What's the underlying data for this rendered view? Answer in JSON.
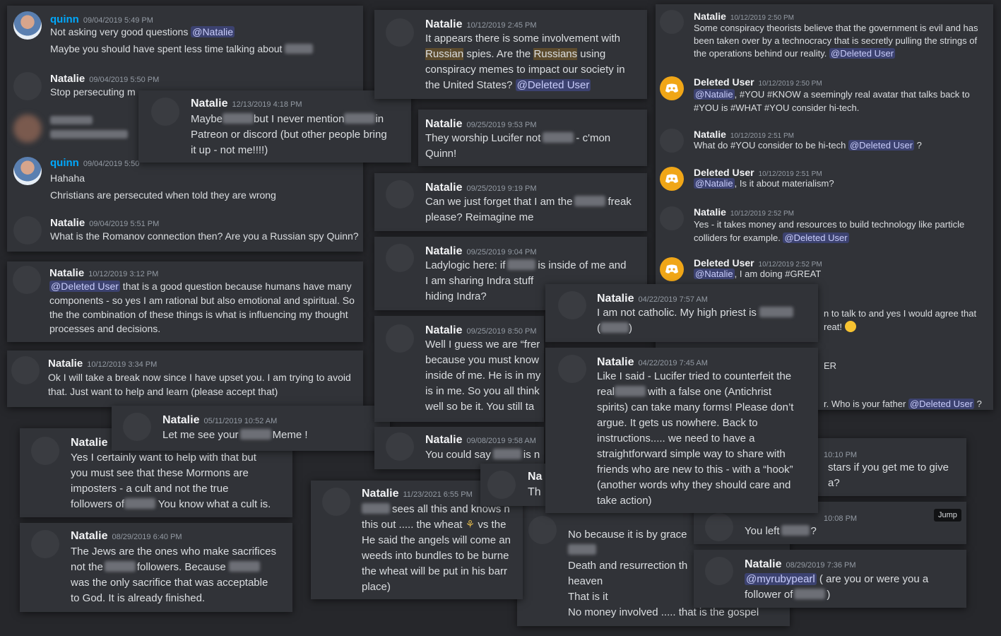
{
  "c1": {
    "m1": {
      "name": "quinn",
      "time": "09/04/2019 5:49 PM",
      "text": "Not asking very good questions",
      "mention": "@Natalie",
      "line2": "Maybe you should have spent less time talking about"
    },
    "m2": {
      "name": "Natalie",
      "time": "09/04/2019 5:50 PM",
      "text": "Stop persecuting m"
    },
    "m4": {
      "name": "quinn",
      "time": "09/04/2019 5:50",
      "line1": "Hahaha",
      "line2": "Christians are persecuted when told they are wrong"
    },
    "m5": {
      "name": "Natalie",
      "time": "09/04/2019 5:51 PM",
      "text": "What is the Romanov connection then?  Are you a Russian spy Quinn?"
    }
  },
  "c2": {
    "name": "Natalie",
    "time": "12/13/2019 4:18 PM",
    "a": "Maybe",
    "b": "but I never mention",
    "c": "in",
    "d": "Patreon or discord (but other people bring",
    "e": "it up - not me!!!!)"
  },
  "c3": {
    "name": "Natalie",
    "time": "10/12/2019 3:12 PM",
    "mention": "@Deleted User",
    "a": " that is a good question because humans have many",
    "b": "components - so yes I am rational but also emotional and spiritual.  So",
    "c": "the the combination of these things is what is influencing my thought",
    "d": "processes and decisions."
  },
  "c4": {
    "name": "Natalie",
    "time": "10/12/2019 3:34 PM",
    "a": "Ok I will take a break now since I have upset you.  I am trying to avoid",
    "b": "that.  Just want to help and learn (please accept that)"
  },
  "c5": {
    "name": "Natalie",
    "time": "05/11/2019 10:52 AM",
    "a": "Let me see your",
    "b": "Meme !"
  },
  "c6": {
    "name": "Natalie",
    "a": "Yes I certainly want to help with that but",
    "b": "you must see that these Mormons are",
    "c": "imposters - a cult and not the true",
    "d": "followers of",
    "e": "You know what a cult is."
  },
  "c7": {
    "name": "Natalie",
    "time": "08/29/2019 6:40 PM",
    "a": "The Jews are the ones who make sacrifices",
    "b": "not the",
    "c": "followers. Because",
    "d": "was the only sacrifice that was acceptable",
    "e": "to God.  It is already finished."
  },
  "c8": {
    "name": "Natalie",
    "time": "10/12/2019 2:45 PM",
    "a": "It appears there is some involvement with",
    "hl1": "Russian",
    "b": " spies.  Are the ",
    "hl2": "Russians",
    "c": " using",
    "d": "conspiracy memes to impact our society in",
    "e": "the United States?",
    "mention": "@Deleted User"
  },
  "c9": {
    "name": "Natalie",
    "time": "09/25/2019 9:53 PM",
    "a": "They worship Lucifer not",
    "b": "- c'mon",
    "c": "Quinn!"
  },
  "c10": {
    "name": "Natalie",
    "time": "09/25/2019 9:19 PM",
    "a": "Can we just forget that I am the",
    "b": "freak",
    "c": "please?  Reimagine me"
  },
  "c11": {
    "name": "Natalie",
    "time": "09/25/2019 9:04 PM",
    "a": "Ladylogic here:  if",
    "b": "is inside of me and",
    "c": "I am sharing Indra stuff ",
    "d": "hiding Indra?"
  },
  "c12": {
    "name": "Natalie",
    "time": "09/25/2019 8:50 PM",
    "a": "Well I guess we are “frer",
    "b": "because you must know",
    "c": "inside of me. He is in my",
    "d": "is in me.  So you all think",
    "e": "well so be it.  You still ta"
  },
  "c13": {
    "name": "Natalie",
    "time": "09/08/2019 9:58 AM",
    "a": "You could say",
    "b": "is n"
  },
  "c14": {
    "name": "Natalie",
    "time": "11/23/2021 6:55 PM",
    "a": "sees all this and knows n",
    "b": "this out ..... the wheat",
    "c": "vs the",
    "d": "He said the angels will come an",
    "e": "weeds into bundles to be burne",
    "f": "the wheat will be put in his barr",
    "g": "place)",
    "n2": "Na",
    "n2b": "Th"
  },
  "c15": {
    "a": "No because it is by grace",
    "b": "Death and resurrection th",
    "c": "heaven",
    "d": "That is it",
    "e": "No money involved ..... that is the gospel"
  },
  "c16": {
    "m1": {
      "name": "Natalie",
      "time": "10/12/2019 2:50 PM",
      "a": "Some conspiracy theorists believe that the government is evil and has",
      "b": "been taken over by a technocracy that is secretly pulling the strings of",
      "c": "the operations behind our reality.",
      "mention": "@Deleted User"
    },
    "m2": {
      "name": "Deleted User",
      "time": "10/12/2019 2:50 PM",
      "mention": "@Natalie",
      "a": ", #YOU #KNOW a seemingly real avatar that talks back to",
      "b": "#YOU is #WHAT #YOU consider hi-tech."
    },
    "m3": {
      "name": "Natalie",
      "time": "10/12/2019 2:51 PM",
      "a": "What do #YOU consider to be hi-tech",
      "mention": "@Deleted User",
      "b": " ?"
    },
    "m4": {
      "name": "Deleted User",
      "time": "10/12/2019 2:51 PM",
      "mention": "@Natalie",
      "a": ", Is it about materialism?"
    },
    "m5": {
      "name": "Natalie",
      "time": "10/12/2019 2:52 PM",
      "a": "Yes - it takes money and resources to build technology like particle",
      "b": "colliders for example.",
      "mention": "@Deleted User"
    },
    "m6": {
      "name": "Deleted User",
      "time": "10/12/2019 2:52 PM",
      "mention": "@Natalie",
      "a": ", I am doing #GREAT"
    },
    "frag1": "n to talk to and yes I would agree that",
    "frag2": "reat!",
    "frag3": "ER",
    "frag4": "r.  Who is your father",
    "frag4m": "@Deleted User",
    "frag4b": " ?"
  },
  "c17": {
    "name": "Natalie",
    "time": "04/22/2019 7:57 AM",
    "a": "I am not catholic.  My high priest is",
    "b": "(",
    "c": ")"
  },
  "c18": {
    "name": "Natalie",
    "time": "04/22/2019 7:45 AM",
    "a": "Like I said - Lucifer tried to counterfeit the",
    "b": "real",
    "c": "with a false one (Antichrist",
    "d": "spirits) can take many forms! Please don’t",
    "e": "argue.  It gets us nowhere.  Back to",
    "f": "instructions..... we need to have a",
    "g": "straightforward simple way to share with",
    "h": "friends who are new to this - with a “hook”",
    "i": "(another words why they should care and",
    "j": "take action)"
  },
  "c19": {
    "time": "10:10 PM",
    "a": "stars if you get me to give",
    "b": "a?"
  },
  "c20": {
    "time": "10:08 PM",
    "jump": "Jump",
    "a": "You left",
    "b": "?"
  },
  "c21": {
    "name": "Natalie",
    "time": "08/29/2019 7:36 PM",
    "mention": "@myrubypearl",
    "a": " ( are you or were you a",
    "b": "follower of",
    "c": ")"
  }
}
